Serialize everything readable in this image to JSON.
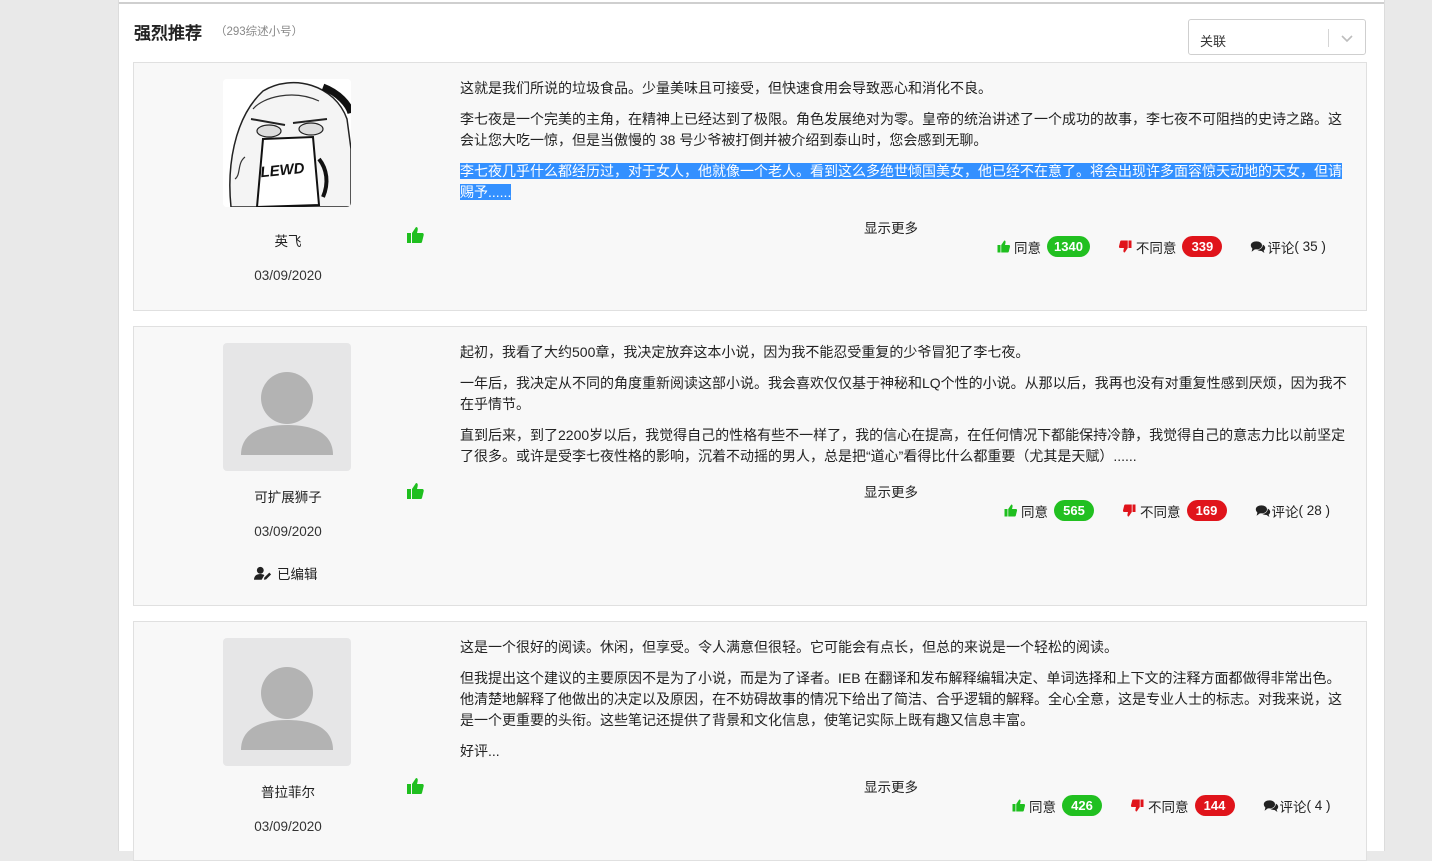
{
  "section": {
    "title": "强烈推荐",
    "subtitle": "（293综述小号）"
  },
  "sort": {
    "value": "关联"
  },
  "common": {
    "show_more": "显示更多",
    "agree_label": "同意",
    "disagree_label": "不同意",
    "comment_label": "评论"
  },
  "colors": {
    "agree": "#21c020",
    "disagree": "#e0141b",
    "thumb_rec": "#1fbf1f",
    "highlight": "#3390ff"
  },
  "reviews": [
    {
      "username": "英飞",
      "date": "03/09/2020",
      "avatar": "lewd-manga-avatar",
      "avatar_text": "LEWD",
      "paragraphs": [
        "这就是我们所说的垃圾食品。少量美味且可接受，但快速食用会导致恶心和消化不良。",
        "李七夜是一个完美的主角，在精神上已经达到了极限。角色发展绝对为零。皇帝的统治讲述了一个成功的故事，李七夜不可阻挡的史诗之路。这会让您大吃一惊，但是当傲慢的 38 号少爷被打倒并被介绍到泰山时，您会感到无聊。",
        "李七夜几乎什么都经历过，对于女人，他就像一个老人。看到这么多绝世倾国美女，他已经不在意了。将会出现许多面容惊天动地的天女，但请赐予......"
      ],
      "agree": "1340",
      "disagree": "339",
      "comments": "( 35 )"
    },
    {
      "username": "可扩展狮子",
      "date": "03/09/2020",
      "avatar": "default-user-avatar",
      "edited": "已编辑",
      "paragraphs": [
        "起初，我看了大约500章，我决定放弃这本小说，因为我不能忍受重复的少爷冒犯了李七夜。",
        "一年后，我决定从不同的角度重新阅读这部小说。我会喜欢仅仅基于神秘和LQ个性的小说。从那以后，我再也没有对重复性感到厌烦，因为我不在乎情节。",
        "直到后来，到了2200岁以后，我觉得自己的性格有些不一样了，我的信心在提高，在任何情况下都能保持冷静，我觉得自己的意志力比以前坚定了很多。或许是受李七夜性格的影响，沉着不动摇的男人，总是把“道心”看得比什么都重要（尤其是天赋）......"
      ],
      "agree": "565",
      "disagree": "169",
      "comments": "( 28 )"
    },
    {
      "username": "普拉菲尔",
      "date": "03/09/2020",
      "avatar": "default-user-avatar",
      "paragraphs": [
        "这是一个很好的阅读。休闲，但享受。令人满意但很轻。它可能会有点长，但总的来说是一个轻松的阅读。",
        "但我提出这个建议的主要原因不是为了小说，而是为了译者。IEB 在翻译和发布解释编辑决定、单词选择和上下文的注释方面都做得非常出色。他清楚地解释了他做出的决定以及原因，在不妨碍故事的情况下给出了简洁、合乎逻辑的解释。全心全意，这是专业人士的标志。对我来说，这是一个更重要的头衔。这些笔记还提供了背景和文化信息，使笔记实际上既有趣又信息丰富。",
        "好评..."
      ],
      "agree": "426",
      "disagree": "144",
      "comments": "( 4 )"
    }
  ]
}
